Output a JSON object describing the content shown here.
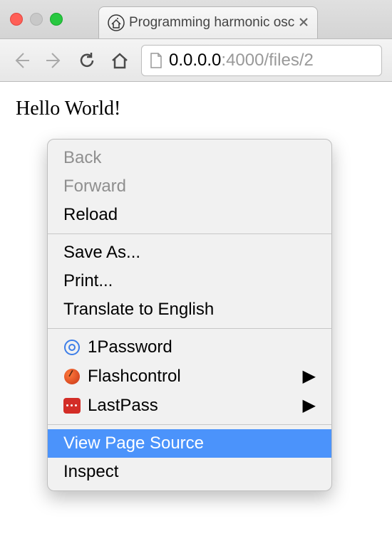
{
  "tab": {
    "title": "Programming harmonic osc",
    "favicon": "house-icon"
  },
  "url": {
    "host": "0.0.0.0",
    "port_path": ":4000/files/2"
  },
  "page": {
    "body_text": "Hello World!"
  },
  "context_menu": {
    "items": [
      {
        "label": "Back",
        "disabled": true
      },
      {
        "label": "Forward",
        "disabled": true
      },
      {
        "label": "Reload"
      }
    ],
    "items2": [
      {
        "label": "Save As..."
      },
      {
        "label": "Print..."
      },
      {
        "label": "Translate to English"
      }
    ],
    "items3": [
      {
        "label": "1Password",
        "icon": "1password-icon"
      },
      {
        "label": "Flashcontrol",
        "icon": "flashcontrol-icon",
        "submenu": true
      },
      {
        "label": "LastPass",
        "icon": "lastpass-icon",
        "submenu": true
      }
    ],
    "items4": [
      {
        "label": "View Page Source",
        "highlight": true
      },
      {
        "label": "Inspect"
      }
    ]
  }
}
